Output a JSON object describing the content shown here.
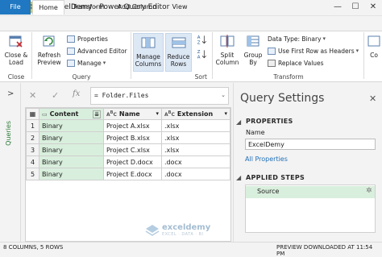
{
  "window": {
    "title": "ExcelDemy - Power Query Editor",
    "app_icon": "X"
  },
  "tabs": [
    "File",
    "Home",
    "Transform",
    "Add Column",
    "View"
  ],
  "ribbon": {
    "close_load": "Close &\nLoad",
    "refresh": "Refresh\nPreview",
    "properties": "Properties",
    "advanced_editor": "Advanced Editor",
    "manage": "Manage",
    "manage_columns": "Manage\nColumns",
    "reduce_rows": "Reduce\nRows",
    "split_column": "Split\nColumn",
    "group_by": "Group\nBy",
    "data_type": "Data Type: Binary",
    "first_row_headers": "Use First Row as Headers",
    "replace_values": "Replace Values",
    "combine": "Co",
    "groups": {
      "close": "Close",
      "query": "Query",
      "sort": "Sort",
      "transform": "Transform"
    }
  },
  "left_rail": {
    "label": "Queries",
    "chevron": ">"
  },
  "formula": {
    "fx": "fx",
    "text": "= Folder.Files"
  },
  "table": {
    "headers": [
      "Content",
      "Name",
      "Extension"
    ],
    "rows": [
      {
        "n": "1",
        "content": "Binary",
        "name": "Project A.xlsx",
        "ext": ".xlsx"
      },
      {
        "n": "2",
        "content": "Binary",
        "name": "Project B.xlsx",
        "ext": ".xlsx"
      },
      {
        "n": "3",
        "content": "Binary",
        "name": "Project C.xlsx",
        "ext": ".xlsx"
      },
      {
        "n": "4",
        "content": "Binary",
        "name": "Project D.docx",
        "ext": ".docx"
      },
      {
        "n": "5",
        "content": "Binary",
        "name": "Project E.docx",
        "ext": ".docx"
      }
    ]
  },
  "query_settings": {
    "title": "Query Settings",
    "properties_header": "PROPERTIES",
    "name_label": "Name",
    "name_value": "ExcelDemy",
    "all_properties": "All Properties",
    "applied_steps_header": "APPLIED STEPS",
    "step": "Source"
  },
  "watermark": {
    "brand": "exceldemy",
    "tag": "EXCEL · DATA · BI"
  },
  "status": {
    "left": "8 COLUMNS, 5 ROWS",
    "right": "PREVIEW DOWNLOADED AT 11:54 PM"
  },
  "colors": {
    "file_tab": "#1f78c1",
    "excel_green": "#1e7145",
    "selected_col": "#d9efdd"
  }
}
